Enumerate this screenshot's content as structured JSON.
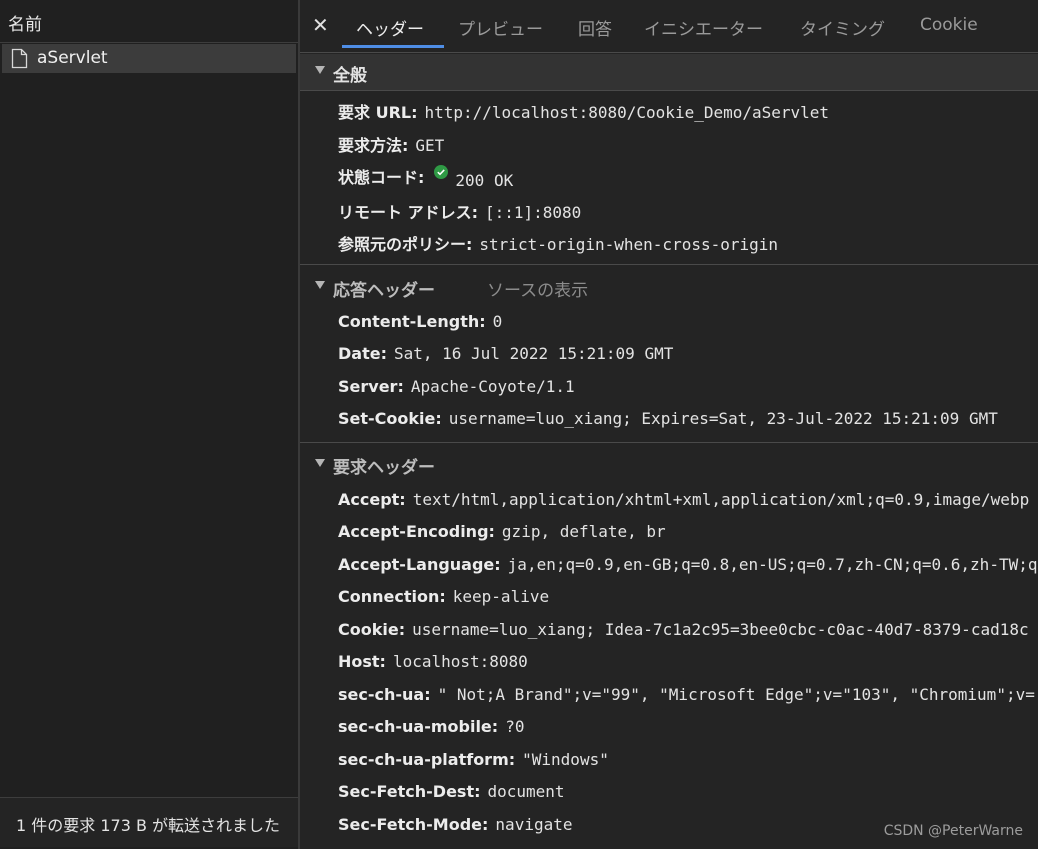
{
  "left_panel": {
    "header": "名前",
    "request_name": "aServlet",
    "status_text": "1 件の要求  173 B が転送されました"
  },
  "tabs": [
    "ヘッダー",
    "プレビュー",
    "回答",
    "イニシエーター",
    "タイミング",
    "Cookie"
  ],
  "active_tab": "ヘッダー",
  "general": {
    "title": "全般",
    "rows": [
      {
        "key": "要求 URL:",
        "value": "http://localhost:8080/Cookie_Demo/aServlet"
      },
      {
        "key": "要求方法:",
        "value": "GET"
      },
      {
        "key": "状態コード:",
        "value": "200 OK"
      },
      {
        "key": "リモート アドレス:",
        "value": "[::1]:8080"
      },
      {
        "key": "参照元のポリシー:",
        "value": "strict-origin-when-cross-origin"
      }
    ]
  },
  "response_headers": {
    "title": "応答ヘッダー",
    "view_source": "ソースの表示",
    "rows": [
      {
        "key": "Content-Length:",
        "value": "0"
      },
      {
        "key": "Date:",
        "value": "Sat, 16 Jul 2022 15:21:09 GMT"
      },
      {
        "key": "Server:",
        "value": "Apache-Coyote/1.1"
      },
      {
        "key": "Set-Cookie:",
        "value": "username=luo_xiang; Expires=Sat, 23-Jul-2022 15:21:09 GMT"
      }
    ]
  },
  "request_headers": {
    "title": "要求ヘッダー",
    "rows": [
      {
        "key": "Accept:",
        "value": "text/html,application/xhtml+xml,application/xml;q=0.9,image/webp"
      },
      {
        "key": "Accept-Encoding:",
        "value": "gzip, deflate, br"
      },
      {
        "key": "Accept-Language:",
        "value": "ja,en;q=0.9,en-GB;q=0.8,en-US;q=0.7,zh-CN;q=0.6,zh-TW;q"
      },
      {
        "key": "Connection:",
        "value": "keep-alive"
      },
      {
        "key": "Cookie:",
        "value": "username=luo_xiang; Idea-7c1a2c95=3bee0cbc-c0ac-40d7-8379-cad18c"
      },
      {
        "key": "Host:",
        "value": "localhost:8080"
      },
      {
        "key": "sec-ch-ua:",
        "value": "\" Not;A Brand\";v=\"99\", \"Microsoft Edge\";v=\"103\", \"Chromium\";v="
      },
      {
        "key": "sec-ch-ua-mobile:",
        "value": "?0"
      },
      {
        "key": "sec-ch-ua-platform:",
        "value": "\"Windows\""
      },
      {
        "key": "Sec-Fetch-Dest:",
        "value": "document"
      },
      {
        "key": "Sec-Fetch-Mode:",
        "value": "navigate"
      }
    ]
  },
  "watermark": "CSDN @PeterWarne",
  "colors": {
    "accent": "#4f8ee6",
    "ok": "#2f9a45",
    "background": "#242424"
  }
}
